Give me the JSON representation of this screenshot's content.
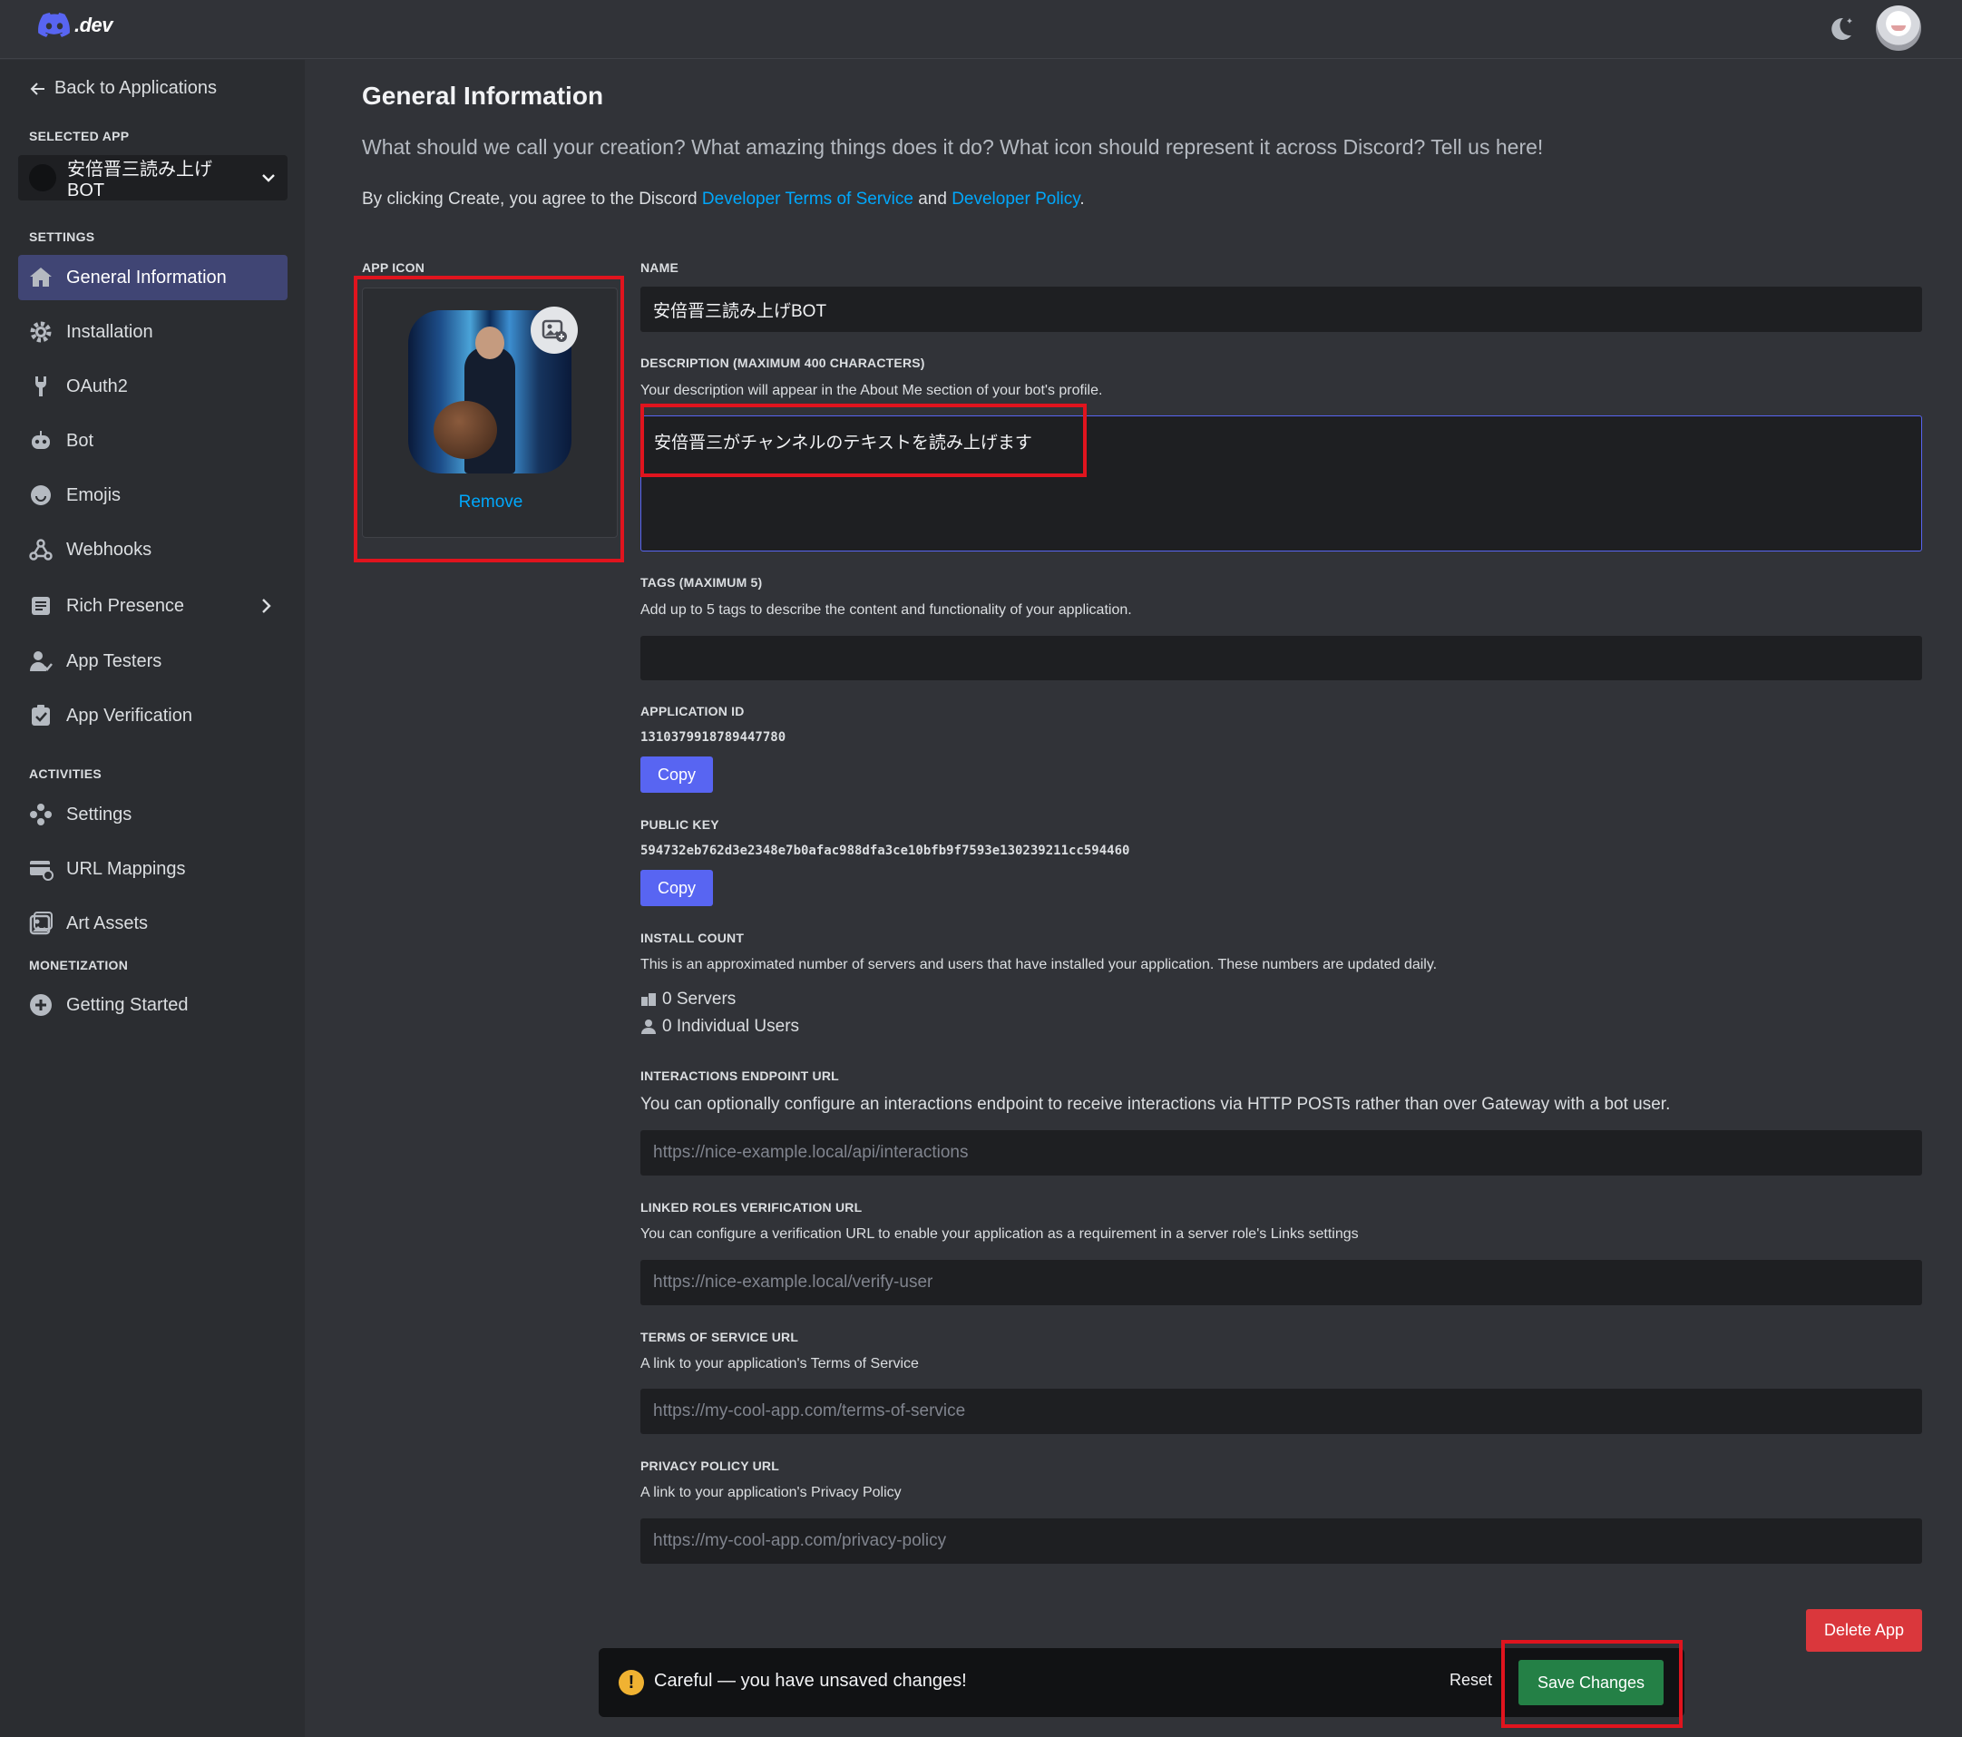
{
  "topbar": {
    "logo_text": ".dev"
  },
  "sidebar": {
    "back_label": "Back to Applications",
    "selected_app_label": "SELECTED APP",
    "selected_app_name": "安倍晋三読み上げBOT",
    "settings_label": "SETTINGS",
    "activities_label": "ACTIVITIES",
    "monetization_label": "MONETIZATION",
    "items": [
      {
        "label": "General Information",
        "icon": "home-icon"
      },
      {
        "label": "Installation",
        "icon": "gear-icon"
      },
      {
        "label": "OAuth2",
        "icon": "wrench-icon"
      },
      {
        "label": "Bot",
        "icon": "robot-icon"
      },
      {
        "label": "Emojis",
        "icon": "smile-icon"
      },
      {
        "label": "Webhooks",
        "icon": "webhook-icon"
      },
      {
        "label": "Rich Presence",
        "icon": "document-icon"
      },
      {
        "label": "App Testers",
        "icon": "person-icon"
      },
      {
        "label": "App Verification",
        "icon": "clipboard-check-icon"
      }
    ],
    "activity_items": [
      {
        "label": "Settings",
        "icon": "gamepad-icon"
      },
      {
        "label": "URL Mappings",
        "icon": "card-link-icon"
      },
      {
        "label": "Art Assets",
        "icon": "image-icon"
      }
    ],
    "monetization_items": [
      {
        "label": "Getting Started",
        "icon": "plus-circle-icon"
      }
    ]
  },
  "main": {
    "title": "General Information",
    "subtitle": "What should we call your creation? What amazing things does it do? What icon should represent it across Discord? Tell us here!",
    "agree_prefix": "By clicking Create, you agree to the Discord ",
    "agree_link1": "Developer Terms of Service",
    "agree_mid": " and ",
    "agree_link2": "Developer Policy",
    "agree_suffix": ".",
    "app_icon_label": "APP ICON",
    "remove_label": "Remove",
    "name_label": "NAME",
    "name_value": "安倍晋三読み上げBOT",
    "description_label": "DESCRIPTION (MAXIMUM 400 CHARACTERS)",
    "description_hint": "Your description will appear in the About Me section of your bot's profile.",
    "description_value": "安倍晋三がチャンネルのテキストを読み上げます",
    "tags_label": "TAGS (MAXIMUM 5)",
    "tags_hint": "Add up to 5 tags to describe the content and functionality of your application.",
    "app_id_label": "APPLICATION ID",
    "app_id_value": "1310379918789447780",
    "copy_label": "Copy",
    "public_key_label": "PUBLIC KEY",
    "public_key_value": "594732eb762d3e2348e7b0afac988dfa3ce10bfb9f7593e130239211cc594460",
    "install_count_label": "INSTALL COUNT",
    "install_count_hint": "This is an approximated number of servers and users that have installed your application. These numbers are updated daily.",
    "servers_count": "0 Servers",
    "users_count": "0 Individual Users",
    "interactions_label": "INTERACTIONS ENDPOINT URL",
    "interactions_hint": "You can optionally configure an interactions endpoint to receive interactions via HTTP POSTs rather than over Gateway with a bot user.",
    "interactions_placeholder": "https://nice-example.local/api/interactions",
    "linked_roles_label": "LINKED ROLES VERIFICATION URL",
    "linked_roles_hint": "You can configure a verification URL to enable your application as a requirement in a server role's Links settings",
    "linked_roles_placeholder": "https://nice-example.local/verify-user",
    "tos_label": "TERMS OF SERVICE URL",
    "tos_hint": "A link to your application's Terms of Service",
    "tos_placeholder": "https://my-cool-app.com/terms-of-service",
    "privacy_label": "PRIVACY POLICY URL",
    "privacy_hint": "A link to your application's Privacy Policy",
    "privacy_placeholder": "https://my-cool-app.com/privacy-policy",
    "delete_label": "Delete App"
  },
  "unsaved_bar": {
    "warning_glyph": "!",
    "message": "Careful — you have unsaved changes!",
    "reset_label": "Reset",
    "save_label": "Save Changes"
  },
  "colors": {
    "accent": "#5865f2",
    "link": "#00a8fc",
    "danger": "#da373c",
    "success": "#248046",
    "highlight": "#e0141e"
  }
}
